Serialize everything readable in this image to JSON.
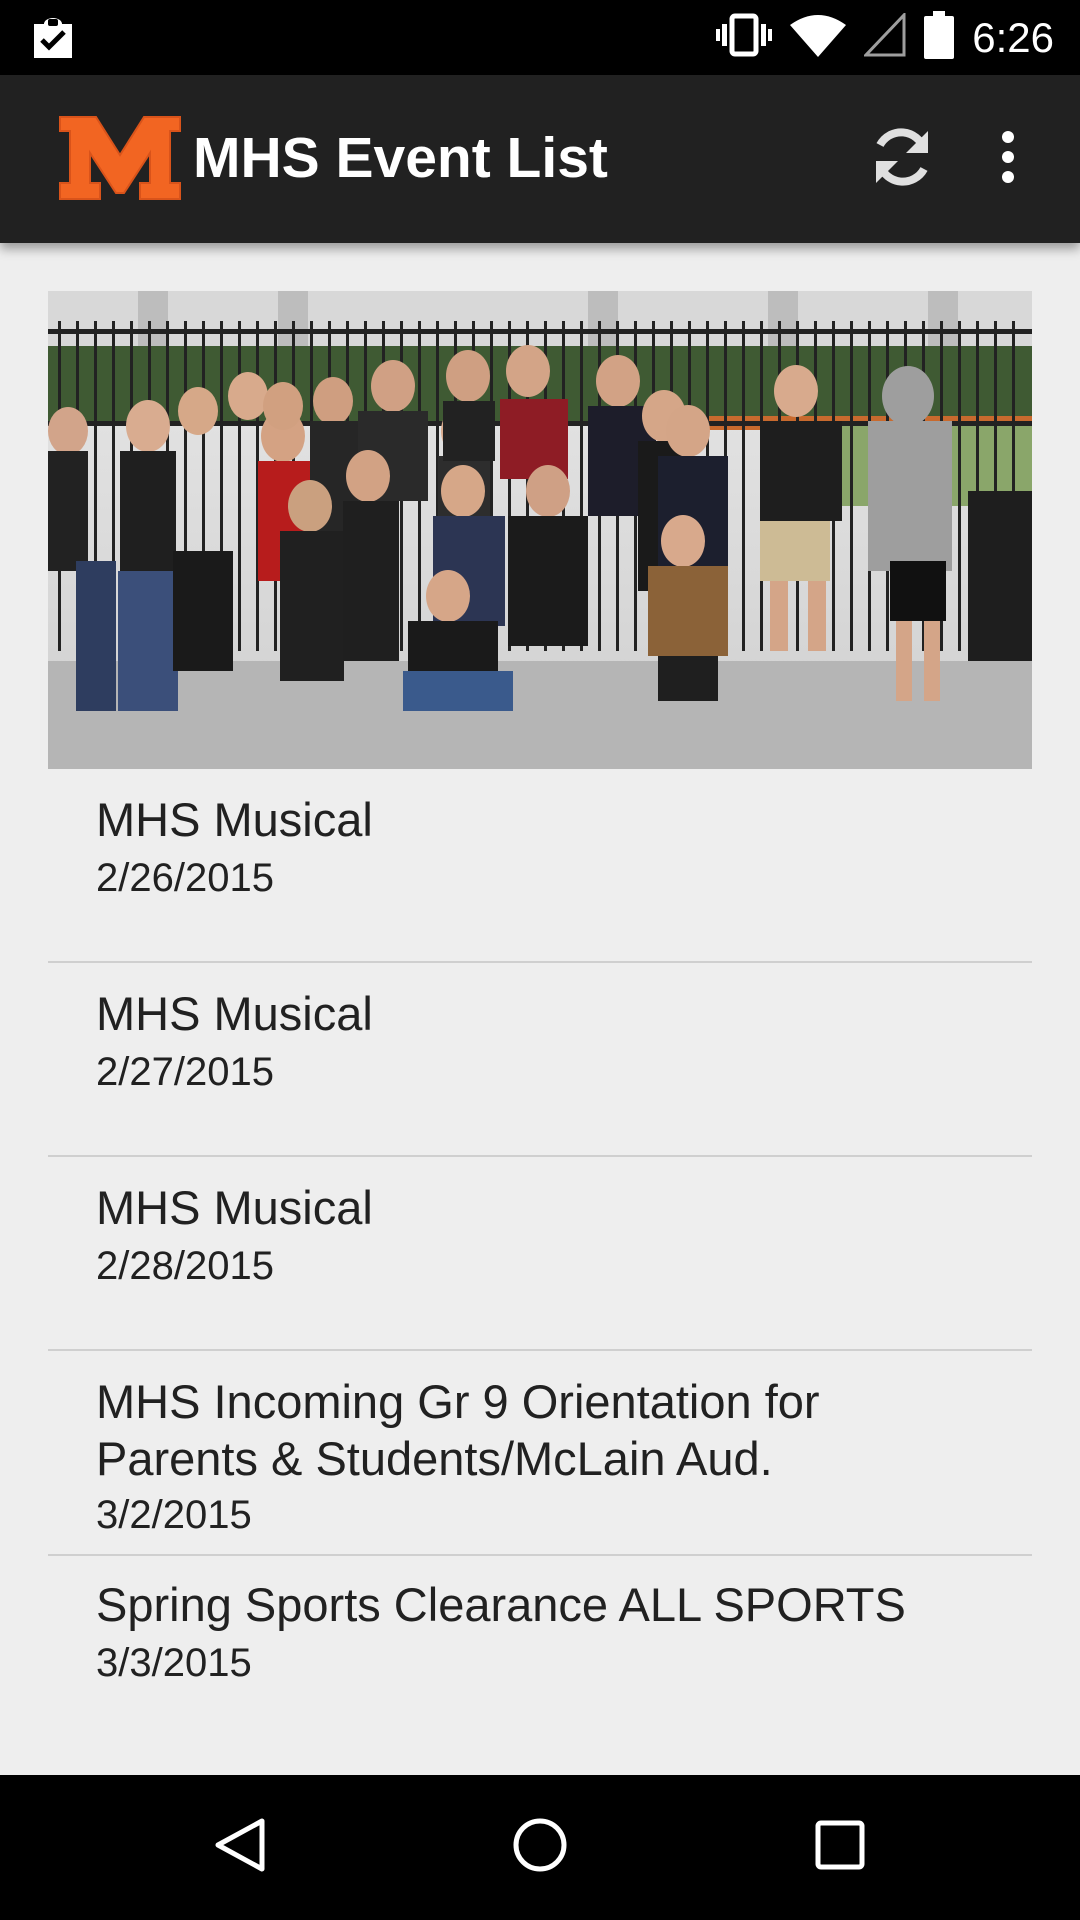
{
  "status_bar": {
    "time": "6:26",
    "icons": [
      "clipboard-check-icon",
      "vibrate-icon",
      "wifi-icon",
      "cell-signal-icon",
      "battery-icon"
    ]
  },
  "app_bar": {
    "logo_icon": "mhs-m-logo-icon",
    "title": "MHS Event List",
    "actions": [
      "refresh-icon",
      "overflow-menu-icon"
    ]
  },
  "hero": {
    "image": "group-photo"
  },
  "events": [
    {
      "title": "MHS Musical",
      "date": "2/26/2015"
    },
    {
      "title": "MHS Musical",
      "date": "2/27/2015"
    },
    {
      "title": "MHS Musical",
      "date": "2/28/2015"
    },
    {
      "title": "MHS Incoming Gr 9 Orientation for Parents & Students/McLain Aud.",
      "date": "3/2/2015"
    },
    {
      "title": "Spring Sports Clearance ALL SPORTS",
      "date": "3/3/2015"
    }
  ],
  "nav_bar": {
    "buttons": [
      "back-icon",
      "home-icon",
      "recents-icon"
    ]
  },
  "colors": {
    "status_bar_bg": "#000000",
    "app_bar_bg": "#212121",
    "content_bg": "#eeeeee",
    "logo_orange": "#f26522",
    "divider": "#cfcfcf",
    "text": "#212121"
  }
}
